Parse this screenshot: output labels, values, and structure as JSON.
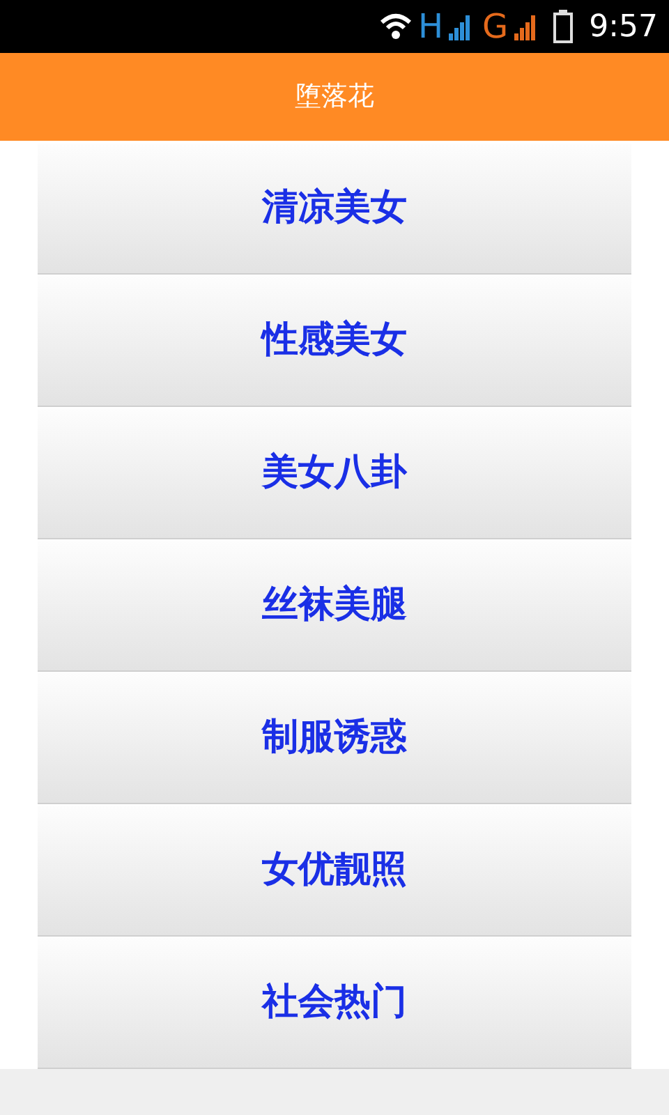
{
  "status_bar": {
    "network_1": "H",
    "network_2": "G",
    "time": "9:57"
  },
  "header": {
    "title": "堕落花"
  },
  "menu": [
    {
      "label": "清凉美女"
    },
    {
      "label": "性感美女"
    },
    {
      "label": "美女八卦"
    },
    {
      "label": "丝袜美腿"
    },
    {
      "label": "制服诱惑"
    },
    {
      "label": "女优靓照"
    },
    {
      "label": "社会热门"
    }
  ]
}
